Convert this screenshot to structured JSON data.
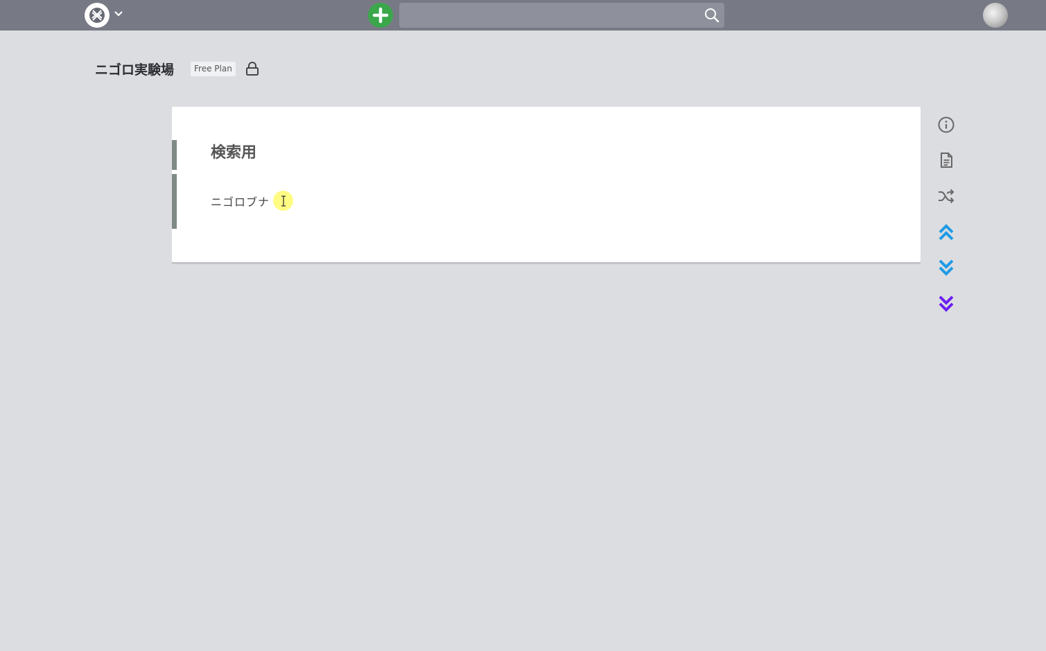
{
  "topbar": {
    "search": {
      "value": "",
      "placeholder": ""
    }
  },
  "project": {
    "name": "ニゴロ実験場",
    "plan_badge": "Free Plan"
  },
  "page": {
    "title": "検索用",
    "lines": [
      "ニゴロブナ"
    ]
  },
  "side_actions": [
    "info-icon",
    "page-icon",
    "shuffle-icon",
    "chevrons-up-icon",
    "chevrons-down-icon",
    "chevrons-down-bottom-icon"
  ],
  "colors": {
    "topbar": "#777a85",
    "background": "#dcdde1",
    "add_button": "#3aa84a",
    "line_bar": "#7f8a86",
    "scroll_up": "#1e9be6",
    "scroll_down": "#1e9be6",
    "scroll_bottom": "#6a1ff0"
  }
}
